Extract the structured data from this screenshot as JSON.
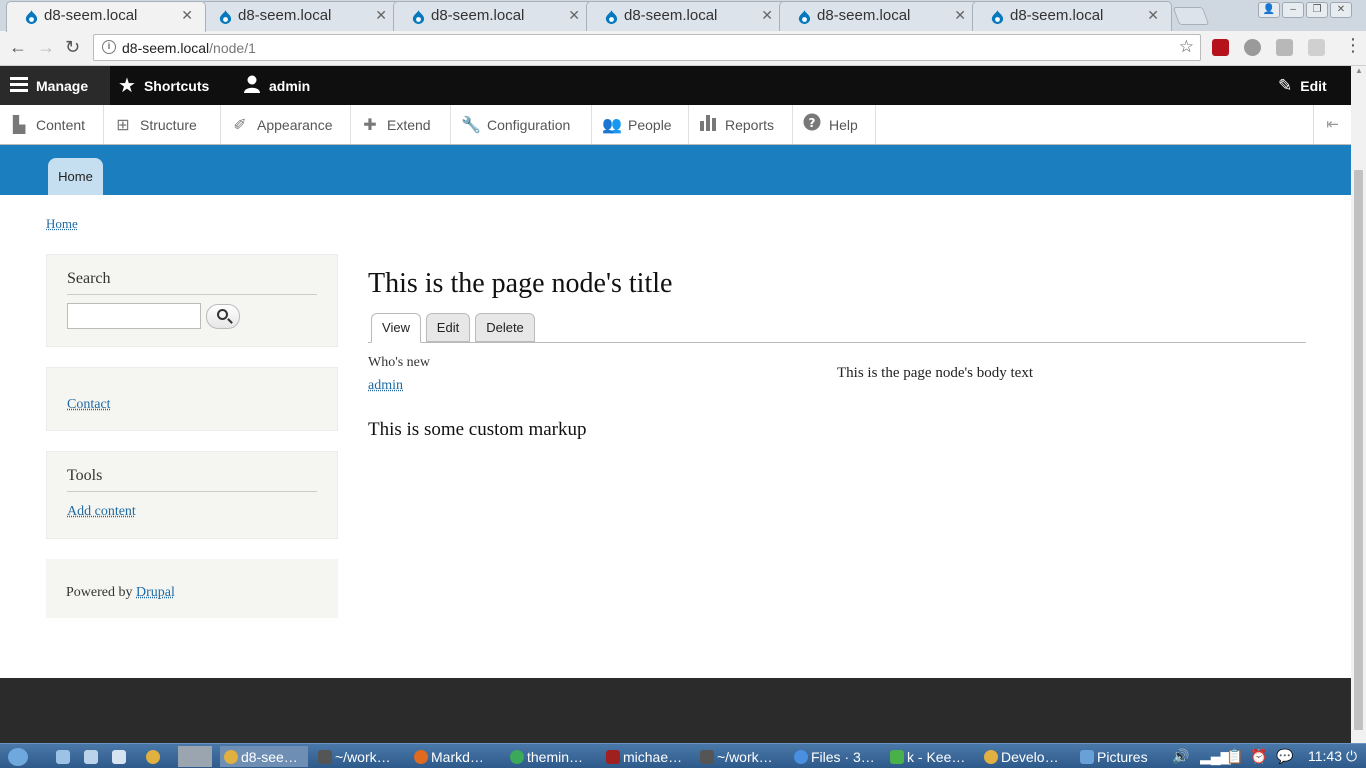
{
  "browser": {
    "tabs": [
      {
        "title": "d8-seem.local",
        "active": true
      },
      {
        "title": "d8-seem.local",
        "active": false
      },
      {
        "title": "d8-seem.local",
        "active": false
      },
      {
        "title": "d8-seem.local",
        "active": false
      },
      {
        "title": "d8-seem.local",
        "active": false
      },
      {
        "title": "d8-seem.local",
        "active": false
      }
    ],
    "url_host": "d8-seem.local",
    "url_path": "/node/1"
  },
  "admin_bar": {
    "manage": "Manage",
    "shortcuts": "Shortcuts",
    "user": "admin",
    "edit": "Edit"
  },
  "admin_tray": {
    "items": [
      "Content",
      "Structure",
      "Appearance",
      "Extend",
      "Configuration",
      "People",
      "Reports",
      "Help"
    ]
  },
  "header": {
    "home_tab": "Home"
  },
  "breadcrumb": {
    "home": "Home"
  },
  "sidebar": {
    "search_title": "Search",
    "search_value": "",
    "contact_link": "Contact",
    "tools_title": "Tools",
    "add_content_link": "Add content",
    "powered_by": "Powered by",
    "drupal_link": "Drupal"
  },
  "main": {
    "title": "This is the page node's title",
    "tabs": [
      "View",
      "Edit",
      "Delete"
    ],
    "whos_new_title": "Who's new",
    "whos_new_user": "admin",
    "custom_markup": "This is some custom markup",
    "body_text": "This is the page node's body text"
  },
  "taskbar": {
    "items": [
      "d8-see…",
      "~/work…",
      "Markd…",
      "themin…",
      "michae…",
      "~/work…",
      "Files · 3…",
      "k - Kee…",
      "Develo…",
      "Pictures"
    ],
    "clock": "11:43"
  },
  "colors": {
    "header_blue": "#1b7fbf",
    "admin_black": "#0f0f0f",
    "link_blue": "#1f6aa3"
  }
}
